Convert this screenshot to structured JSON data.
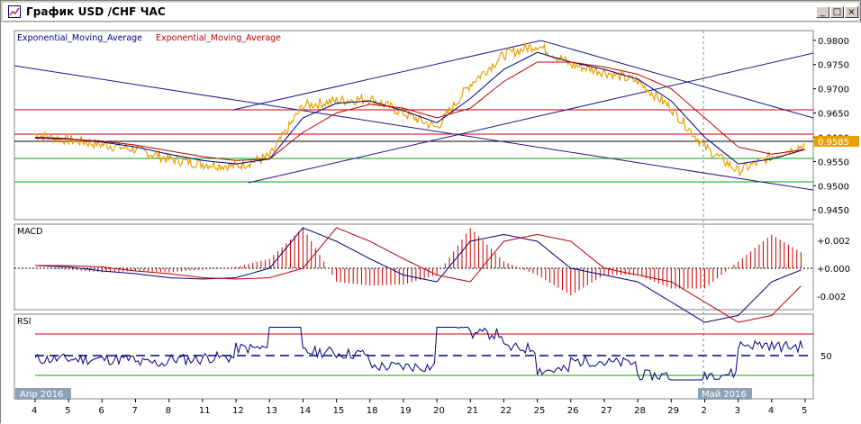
{
  "window": {
    "title": "График USD /CHF ЧАС",
    "buttons": {
      "minimize": "_",
      "maximize": "□",
      "close": "×"
    }
  },
  "legend": {
    "ema_blue": "Exponential_Moving_Average",
    "ema_red": "Exponential_Moving_Average"
  },
  "current_price": "0.9585",
  "price_axis": [
    "0.9800",
    "0.9750",
    "0.9700",
    "0.9650",
    "0.9600",
    "0.9550",
    "0.9500",
    "0.9450"
  ],
  "macd": {
    "label": "MACD",
    "ticks": [
      "+0.002",
      "+0.000",
      "-0.002"
    ]
  },
  "rsi": {
    "label": "RSI",
    "ticks": [
      "50"
    ]
  },
  "month_labels": {
    "april": "Апр 2016",
    "may": "Май 2016"
  },
  "date_labels": [
    "4",
    "5",
    "6",
    "7",
    "8",
    "11",
    "12",
    "13",
    "14",
    "15",
    "18",
    "19",
    "20",
    "21",
    "22",
    "25",
    "26",
    "27",
    "28",
    "29",
    "2",
    "3",
    "4",
    "5"
  ],
  "colors": {
    "price": "#e8a000",
    "ema_fast": "#000080",
    "ema_slow": "#c00000",
    "trendline": "#1a1a8c",
    "hline_red": "#cc0000",
    "hline_green": "#00aa00",
    "rsi_line": "#000080",
    "rsi_overbought": "#cc00cc",
    "rsi_oversold": "#00cc00",
    "macd_hist": "#cc0000"
  },
  "chart_data": {
    "type": "line",
    "title": "График USD /CHF ЧАС",
    "ylim": [
      0.943,
      0.982
    ],
    "x": [
      "4",
      "5",
      "6",
      "7",
      "8",
      "11",
      "12",
      "13",
      "14",
      "15",
      "18",
      "19",
      "20",
      "21",
      "22",
      "25",
      "26",
      "27",
      "28",
      "29",
      "2",
      "3",
      "4",
      "5"
    ],
    "series": [
      {
        "name": "USD/CHF",
        "values": [
          0.9605,
          0.9595,
          0.9585,
          0.9575,
          0.9555,
          0.9545,
          0.954,
          0.956,
          0.9665,
          0.9675,
          0.968,
          0.965,
          0.962,
          0.971,
          0.977,
          0.979,
          0.975,
          0.9735,
          0.9715,
          0.966,
          0.958,
          0.953,
          0.956,
          0.9585
        ]
      },
      {
        "name": "Exponential_Moving_Average",
        "values": [
          0.96,
          0.9597,
          0.959,
          0.958,
          0.9565,
          0.9552,
          0.9545,
          0.9555,
          0.964,
          0.967,
          0.9675,
          0.9655,
          0.963,
          0.968,
          0.974,
          0.9775,
          0.9755,
          0.974,
          0.972,
          0.9675,
          0.96,
          0.9545,
          0.9555,
          0.9575
        ]
      },
      {
        "name": "Exponential_Moving_Average",
        "values": [
          0.9598,
          0.9596,
          0.9592,
          0.9584,
          0.9572,
          0.956,
          0.9552,
          0.9555,
          0.961,
          0.965,
          0.9668,
          0.966,
          0.964,
          0.966,
          0.9715,
          0.9755,
          0.9755,
          0.9745,
          0.973,
          0.97,
          0.964,
          0.958,
          0.9565,
          0.9575
        ]
      }
    ]
  }
}
